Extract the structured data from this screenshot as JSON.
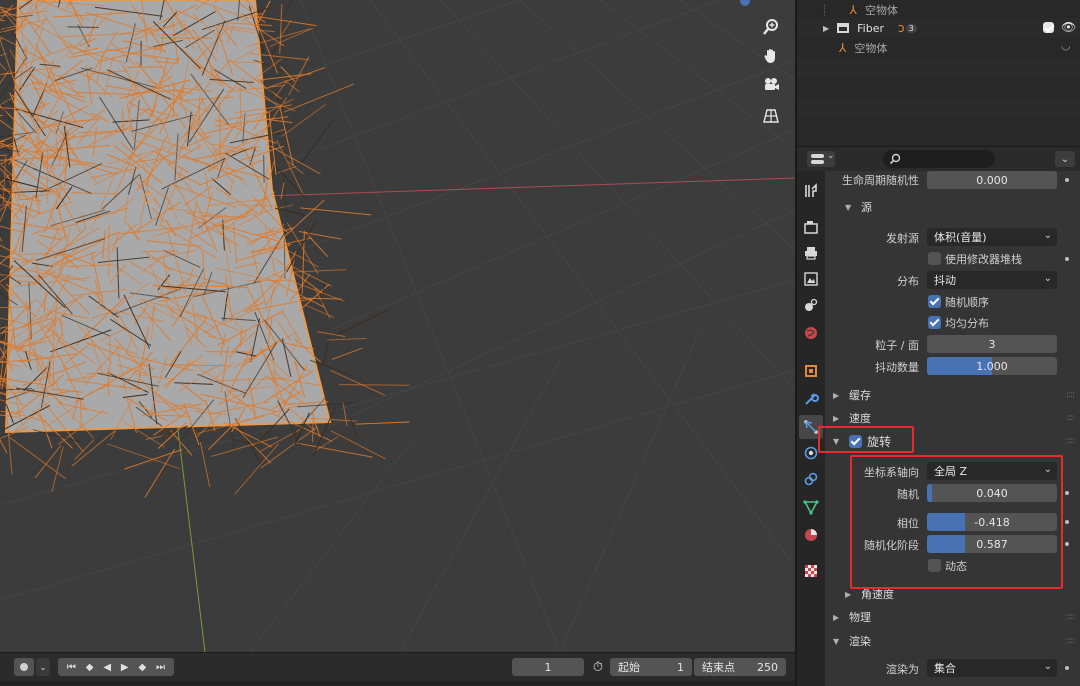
{
  "outliner": {
    "rows": [
      {
        "label": "空物体"
      },
      {
        "label": "Fiber",
        "badge": "3"
      },
      {
        "label": "空物体"
      }
    ]
  },
  "properties": {
    "search": {
      "placeholder": ""
    },
    "lifetime_random": {
      "label": "生命周期随机性",
      "value": "0.000"
    },
    "source": {
      "header": "源",
      "emit_from": {
        "label": "发射源",
        "value": "体积(音量)"
      },
      "use_modifier_stack": {
        "label": "使用修改器堆栈",
        "checked": false
      },
      "distribution": {
        "label": "分布",
        "value": "抖动"
      },
      "random_order": {
        "label": "随机顺序",
        "checked": true
      },
      "even_distribution": {
        "label": "均匀分布",
        "checked": true
      },
      "particles_per_face": {
        "label": "粒子 / 面",
        "value": "3"
      },
      "jitter_amount": {
        "label": "抖动数量",
        "value": "1.000",
        "fraction": 0.5
      }
    },
    "panels": {
      "cache": "缓存",
      "velocity": "速度",
      "rotation": "旋转",
      "angular_velocity": "角速度",
      "physics": "物理",
      "render": "渲染"
    },
    "rotation": {
      "checked": true,
      "orientation_axis": {
        "label": "坐标系轴向",
        "value": "全局 Z"
      },
      "random": {
        "label": "随机",
        "value": "0.040",
        "fraction": 0.04
      },
      "phase": {
        "label": "相位",
        "value": "-0.418",
        "fraction": 0.29
      },
      "random_phase": {
        "label": "随机化阶段",
        "value": "0.587",
        "fraction": 0.29
      },
      "dynamic": {
        "label": "动态",
        "checked": false
      }
    },
    "render": {
      "render_as": {
        "label": "渲染为",
        "value": "集合"
      }
    }
  },
  "timeline": {
    "current_frame": "1",
    "start_label": "起始",
    "start_value": "1",
    "end_label": "结束点",
    "end_value": "250"
  },
  "colors": {
    "accent": "#4772b3",
    "highlight_box": "#e52b2b",
    "fiber": "#e07a2a",
    "x_axis": "#b04a56",
    "y_axis": "#7a9a3a"
  }
}
